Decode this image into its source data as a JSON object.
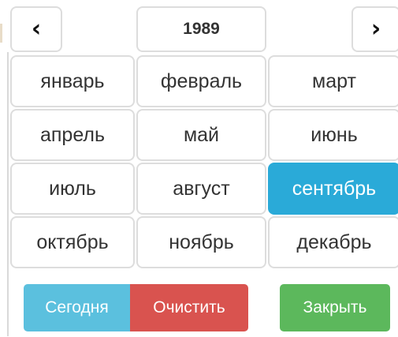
{
  "header": {
    "prev_icon": "chevron-left-icon",
    "year": "1989",
    "next_icon": "chevron-right-icon"
  },
  "months": [
    "январь",
    "февраль",
    "март",
    "апрель",
    "май",
    "июнь",
    "июль",
    "август",
    "сентябрь",
    "октябрь",
    "ноябрь",
    "декабрь"
  ],
  "selected_month": "сентябрь",
  "footer": {
    "today_label": "Сегодня",
    "clear_label": "Очистить",
    "close_label": "Закрыть"
  },
  "colors": {
    "selected": "#2aaad8",
    "today": "#5bc0de",
    "clear": "#d9534f",
    "close": "#5cb85c"
  }
}
